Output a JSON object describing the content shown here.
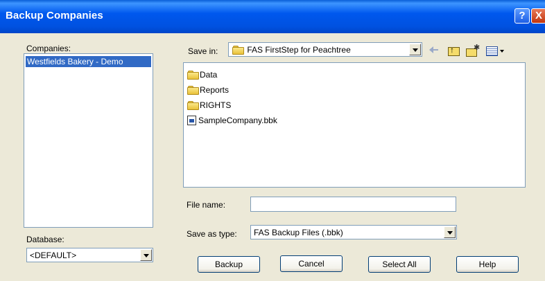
{
  "window": {
    "title": "Backup Companies"
  },
  "companies": {
    "label": "Companies:",
    "items": [
      "Westfields Bakery - Demo"
    ]
  },
  "database": {
    "label": "Database:",
    "value": "<DEFAULT>"
  },
  "save_in": {
    "label": "Save in:",
    "value": "FAS FirstStep for Peachtree"
  },
  "files": [
    {
      "name": "Data",
      "type": "folder"
    },
    {
      "name": "Reports",
      "type": "folder"
    },
    {
      "name": "RIGHTS",
      "type": "folder"
    },
    {
      "name": "SampleCompany.bbk",
      "type": "file"
    }
  ],
  "file_name": {
    "label": "File name:",
    "value": ""
  },
  "save_as_type": {
    "label": "Save as type:",
    "value": "FAS Backup Files (.bbk)"
  },
  "buttons": {
    "backup": "Backup",
    "cancel": "Cancel",
    "select_all": "Select All",
    "help": "Help"
  },
  "title_buttons": {
    "help": "?",
    "close": "X"
  }
}
